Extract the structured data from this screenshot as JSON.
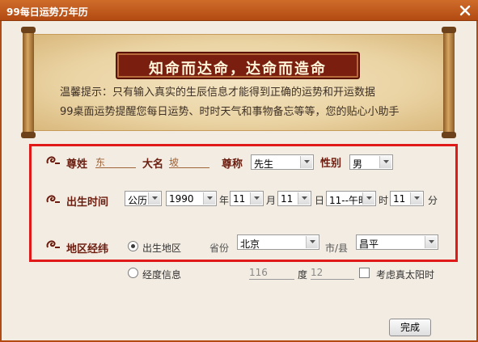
{
  "window": {
    "title": "99每日运势万年历",
    "close_icon": "close-icon"
  },
  "banner": {
    "heading": "知命而达命，达命而造命",
    "tip_line1": "温馨提示：只有输入真实的生辰信息才能得到正确的运势和开运数据",
    "tip_line2": "99桌面运势提醒您每日运势、时时天气和事物备忘等等，您的贴心小助手"
  },
  "form": {
    "surname_label": "尊姓",
    "surname_value": "东",
    "given_name_label": "大名",
    "given_name_value": "坡",
    "title_label": "尊称",
    "title_value": "先生",
    "gender_label": "性别",
    "gender_value": "男",
    "birth_label": "出生时间",
    "calendar_value": "公历",
    "year_value": "1990",
    "year_unit": "年",
    "month_value": "11",
    "month_unit": "月",
    "day_value": "11",
    "day_unit": "日",
    "hour_value": "11--午时",
    "hour_unit": "时",
    "minute_value": "11",
    "minute_unit": "分",
    "location_label": "地区经纬",
    "birthplace_option": "出生地区",
    "province_label": "省份",
    "province_value": "北京",
    "city_label": "市/县",
    "city_value": "昌平",
    "longitude_option": "经度信息",
    "longitude_value": "116",
    "degree_unit": "度",
    "minute_geo_value": "12",
    "true_solar_label": "考虑真太阳时"
  },
  "footer": {
    "done_label": "完成"
  },
  "colors": {
    "titlebar": "#b24a12",
    "highlight_box": "#e01919",
    "label": "#6b1d10",
    "banner": "#7a1f0f"
  }
}
